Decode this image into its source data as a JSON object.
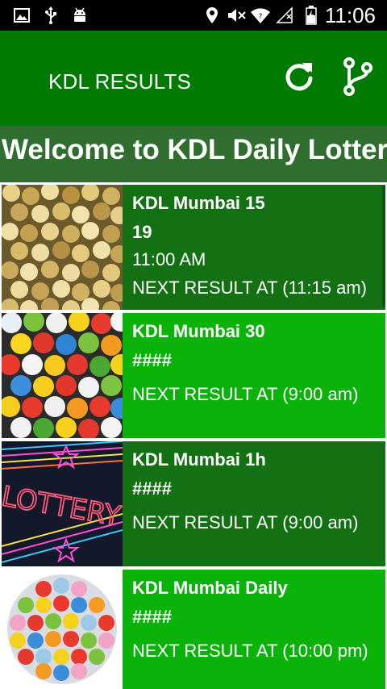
{
  "status_bar": {
    "time": "11:06",
    "icons": [
      "image-icon",
      "usb-icon",
      "android-icon",
      "location-icon",
      "mute-icon",
      "wifi-icon",
      "no-signal-icon",
      "battery-icon"
    ]
  },
  "app_bar": {
    "title": "KDL RESULTS",
    "actions": [
      "refresh-icon",
      "share-icon"
    ],
    "color": "#007a00"
  },
  "welcome": {
    "text": "Welcome to KDL Daily Lottery"
  },
  "cards": [
    {
      "name": "KDL Mumbai 15",
      "number": "19",
      "time": "11:00 AM",
      "next": "NEXT RESULT AT (11:15 am)",
      "image": "golden-lottery-balls"
    },
    {
      "name": "KDL Mumbai 30",
      "number": "####",
      "time": "",
      "next": "NEXT RESULT AT (9:00 am)",
      "image": "colorful-lottery-balls"
    },
    {
      "name": "KDL Mumbai 1h",
      "number": "####",
      "time": "",
      "next": "NEXT RESULT AT (9:00 am)",
      "image": "neon-lottery-sign"
    },
    {
      "name": "KDL Mumbai Daily",
      "number": "####",
      "time": "",
      "next": "NEXT RESULT AT (10:00 pm)",
      "image": "lottery-ball-sphere"
    }
  ],
  "colors": {
    "card_dark": "#137013",
    "card_light": "#0ab20a",
    "welcome_bg": "#2f6e2f"
  }
}
